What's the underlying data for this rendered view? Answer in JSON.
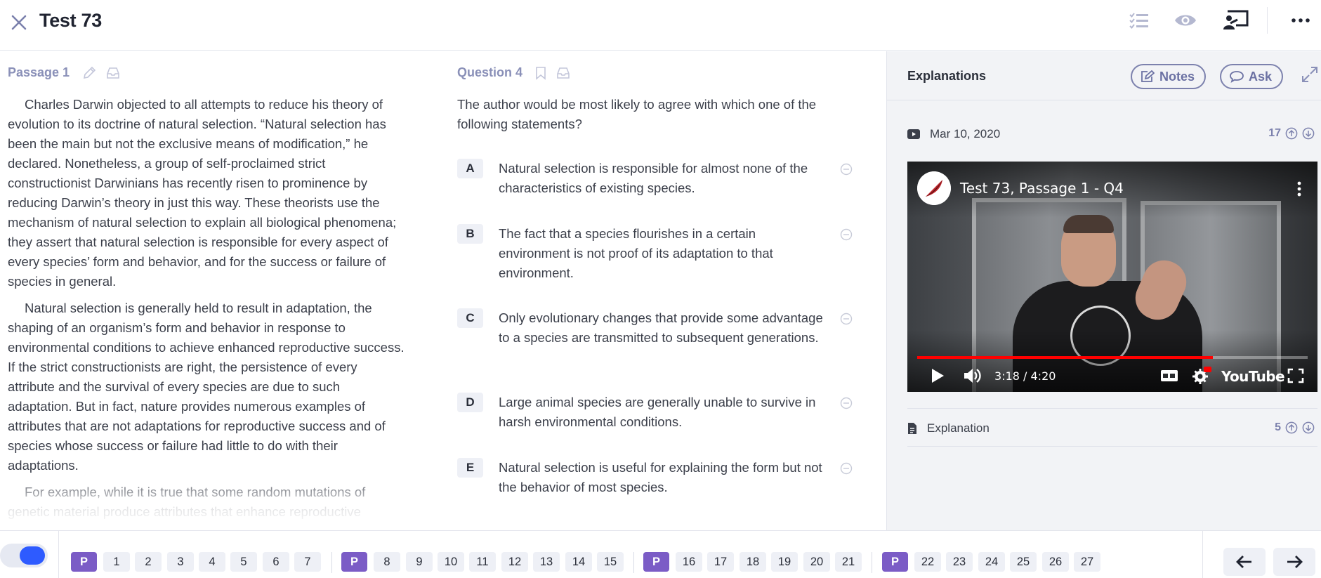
{
  "header": {
    "title": "Test 73",
    "icons": [
      "close-icon",
      "task-list-icon",
      "eye-icon",
      "present-icon",
      "more-icon"
    ]
  },
  "passage": {
    "label": "Passage 1",
    "paragraphs": [
      "Charles Darwin objected to all attempts to reduce his theory of evolution to its doctrine of natural selection. “Natural selection has been the main but not the exclusive means of modification,” he declared. Nonetheless, a group of self-proclaimed strict constructionist Darwinians has recently risen to prominence by reducing Darwin’s theory in just this way. These theorists use the mechanism of natural selection to explain all biological phenomena; they assert that natural selection is responsible for every aspect of every species’ form and behavior, and for the success or failure of species in general.",
      "Natural selection is generally held to result in adaptation, the shaping of an organism’s form and behavior in response to environmental conditions to achieve enhanced reproductive success. If the strict constructionists are right, the persistence of every attribute and the survival of every species are due to such adaptation. But in fact, nature provides numerous examples of attributes that are not adaptations for reproductive success and of species whose success or failure had little to do with their adaptations.",
      "For example, while it is true that some random mutations of genetic material produce attributes that enhance reproductive"
    ]
  },
  "question": {
    "label": "Question 4",
    "stem": "The author would be most likely to agree with which one of the following statements?",
    "choices": [
      {
        "letter": "A",
        "text": "Natural selection is responsible for almost none of the characteristics of existing species."
      },
      {
        "letter": "B",
        "text": "The fact that a species flourishes in a certain environment is not proof of its adaptation to that environment."
      },
      {
        "letter": "C",
        "text": "Only evolutionary changes that provide some advantage to a species are transmitted to subsequent generations."
      },
      {
        "letter": "D",
        "text": "Large animal species are generally unable to survive in harsh environmental conditions."
      },
      {
        "letter": "E",
        "text": "Natural selection is useful for explaining the form but not the behavior of most species."
      }
    ]
  },
  "explanations": {
    "title": "Explanations",
    "notes_label": "Notes",
    "ask_label": "Ask",
    "video_entry": {
      "date": "Mar 10, 2020",
      "votes": "17"
    },
    "video": {
      "title": "Test 73, Passage 1 - Q4",
      "time": "3:18 / 4:20",
      "brand": "YouTube",
      "progress": 0.757
    },
    "text_entry": {
      "label": "Explanation",
      "votes": "5"
    }
  },
  "footer": {
    "groups": [
      {
        "p": "P",
        "items": [
          "1",
          "2",
          "3",
          "4",
          "5",
          "6",
          "7"
        ]
      },
      {
        "p": "P",
        "items": [
          "8",
          "9",
          "10",
          "11",
          "12",
          "13",
          "14",
          "15"
        ]
      },
      {
        "p": "P",
        "items": [
          "16",
          "17",
          "18",
          "19",
          "20",
          "21"
        ]
      },
      {
        "p": "P",
        "items": [
          "22",
          "23",
          "24",
          "25",
          "26",
          "27"
        ]
      }
    ]
  },
  "colors": {
    "accent": "#7b5cc6",
    "toggle": "#2e5bff",
    "label": "#8a90b8",
    "progress": "#ff0000"
  }
}
